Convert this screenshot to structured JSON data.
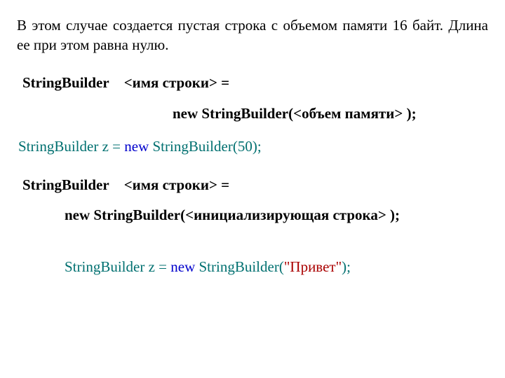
{
  "intro": "В этом случае создается пустая строка с объемом памяти 16 байт. Длина ее при этом равна нулю.",
  "decl1": {
    "type": "StringBuilder",
    "name_ph": "<имя строки>",
    "eq": " =",
    "new_kw": "new",
    "ctor": " StringBuilder(",
    "arg_ph": "<объем памяти>",
    "close": " );"
  },
  "ex1": {
    "a": "StringBuilder z = ",
    "new_kw": "new",
    "b": " StringBuilder(50);"
  },
  "decl2": {
    "type": "StringBuilder",
    "name_ph": "<имя строки>",
    "eq": " =",
    "new_kw": "new",
    "ctor": " StringBuilder(",
    "arg_ph": "<инициализирующая строка>",
    "close": " );"
  },
  "ex2": {
    "a": "StringBuilder z = ",
    "new_kw": "new",
    "b": " StringBuilder(",
    "str": "\"Привет\"",
    "c": ");"
  }
}
